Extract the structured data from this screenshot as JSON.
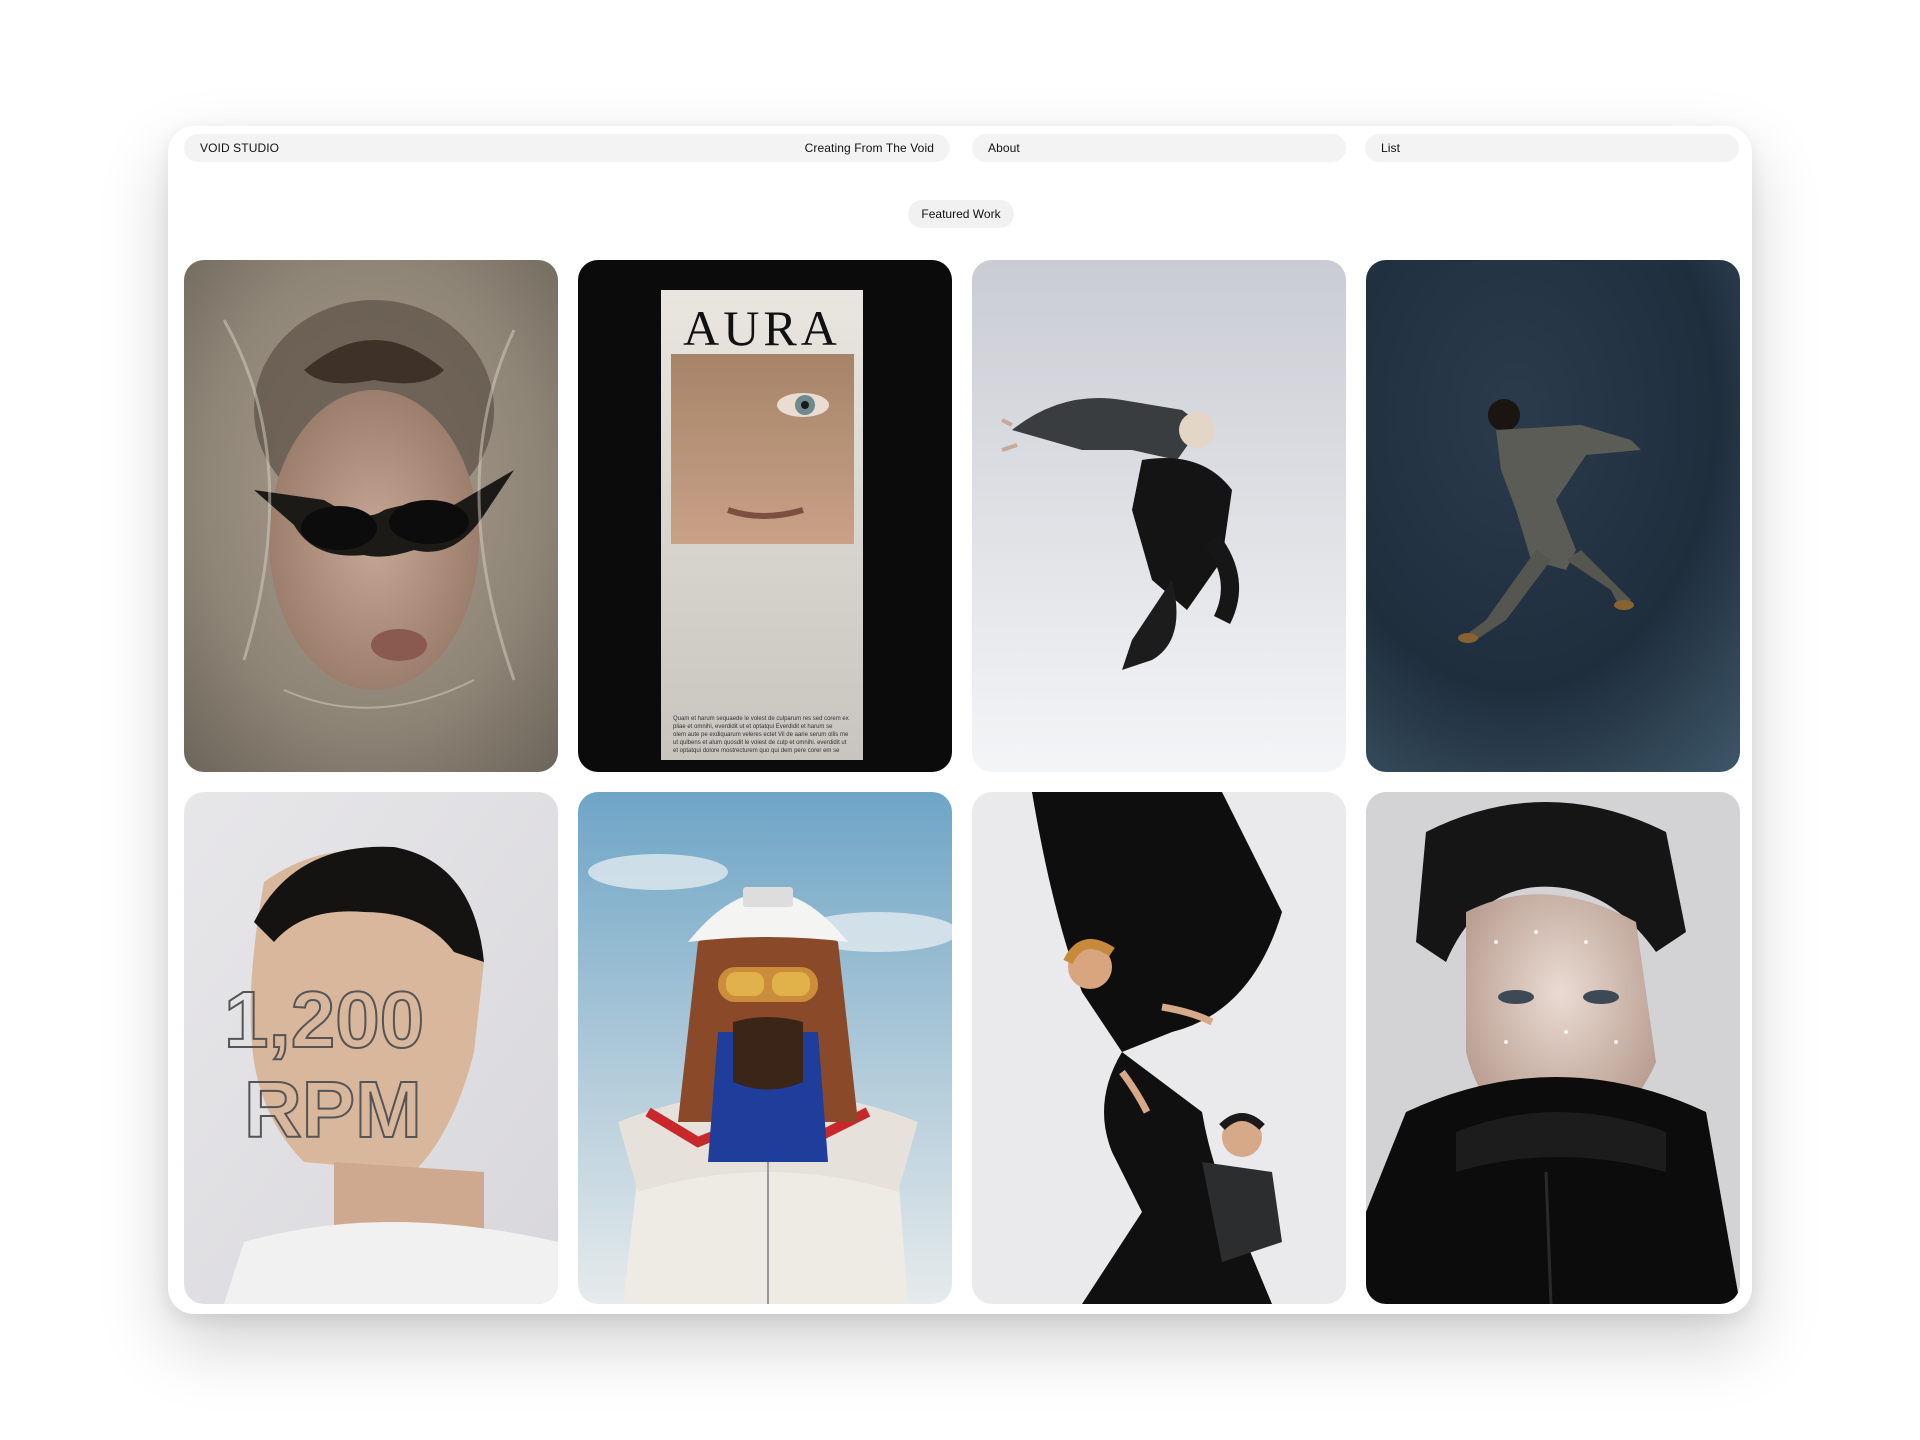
{
  "nav": {
    "brand": "VOID STUDIO",
    "tagline": "Creating From The Void",
    "about": "About",
    "list": "List"
  },
  "section": {
    "label": "Featured Work"
  },
  "cards": [
    {
      "subject": "portrait with sunglasses under plastic wrap"
    },
    {
      "subject": "AURA editorial poster",
      "poster_title": "AURA",
      "poster_body_lines": [
        "Quam et harum sequaede le volest de culparum res sed corem ex",
        "pliae et omnihi, everdidit ut et optatqui Everdidit et harum se",
        "olem aute pe exdiquarum veleres ectet Vil de aarie serum ollis me",
        "ut qulbens et alum quosdit le volest de culp et omnihi. everdidit ut",
        "et optatqui dolore mostrecturem quo qui dem pere corer em se"
      ]
    },
    {
      "subject": "figure leaping against pale sky"
    },
    {
      "subject": "figure jumping against dark blue backdrop"
    },
    {
      "subject": "profile portrait with outline text",
      "overlay_line1": "1,200",
      "overlay_line2": "RPM"
    },
    {
      "subject": "person in cap and goggles under blue sky"
    },
    {
      "subject": "two figures in black, one upside down"
    },
    {
      "subject": "wet-face portrait in black leather"
    }
  ],
  "colors": {
    "nav_pill": "#f3f3f3",
    "text": "#111111",
    "card_dark": "#0b0b0b"
  }
}
